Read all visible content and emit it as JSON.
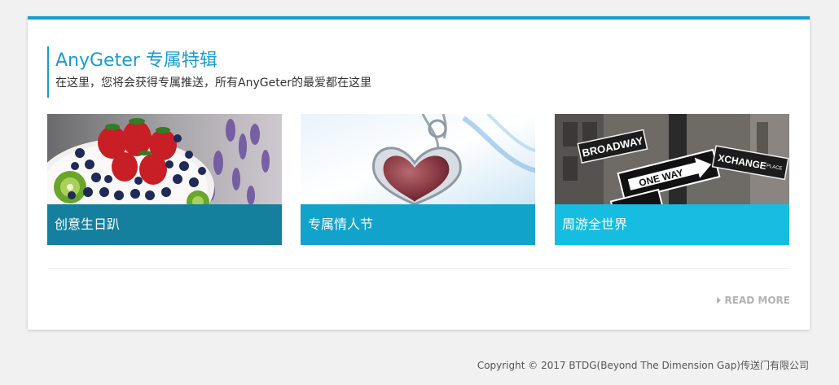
{
  "section": {
    "title": "AnyGeter 专属特辑",
    "subtitle": "在这里，您将会获得专属推送，所有AnyGeter的最爱都在这里",
    "accent_color": "#1a9ccc"
  },
  "cards": [
    {
      "label": "创意生日趴",
      "bar_color": "#157f9e",
      "image": "birthday-cake-image"
    },
    {
      "label": "专属情人节",
      "bar_color": "#12a3cb",
      "image": "heart-pendant-image"
    },
    {
      "label": "周游全世界",
      "bar_color": "#16bde0",
      "image": "street-signs-image"
    }
  ],
  "read_more": {
    "label": "READ MORE"
  },
  "footer": {
    "copyright": "Copyright © 2017 BTDG(Beyond The Dimension Gap)传送门有限公司"
  },
  "street_signs": {
    "sign1": "BROADWAY",
    "sign2": "ONE WAY",
    "sign3": "XCHANGE",
    "sign3_small": "PLACE"
  }
}
